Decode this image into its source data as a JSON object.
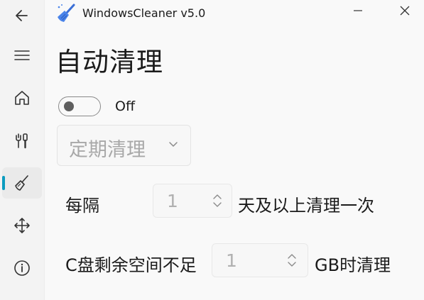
{
  "window": {
    "title": "WindowsCleaner v5.0",
    "accent": "#0b9bbf"
  },
  "nav": {
    "items": [
      {
        "icon": "back-arrow-icon",
        "selected": false
      },
      {
        "icon": "hamburger-menu-icon",
        "selected": false
      },
      {
        "icon": "home-icon",
        "selected": false
      },
      {
        "icon": "tools-icon",
        "selected": false
      },
      {
        "icon": "broom-icon",
        "selected": true
      },
      {
        "icon": "move-icon",
        "selected": false
      },
      {
        "icon": "info-icon",
        "selected": false
      }
    ]
  },
  "page": {
    "title": "自动清理",
    "toggle": {
      "state": "Off",
      "on": false
    },
    "schedule_dropdown": {
      "value": "定期清理"
    },
    "interval_row": {
      "prefix": "每隔",
      "value": "1",
      "suffix": "天及以上清理一次"
    },
    "disk_row": {
      "prefix": "C盘剩余空间不足",
      "value": "1",
      "suffix": "GB时清理"
    }
  }
}
